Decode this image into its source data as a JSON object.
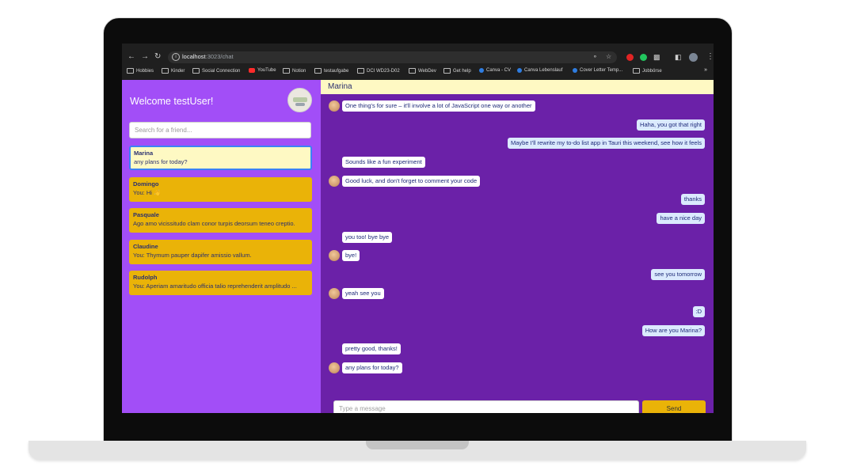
{
  "browser": {
    "url_host": "localhost",
    "url_path": ":3023/chat",
    "bookmarks": [
      {
        "label": "Hobbies",
        "icon": "folder-icon"
      },
      {
        "label": "Kinder",
        "icon": "folder-icon"
      },
      {
        "label": "Social Connection",
        "icon": "folder-icon"
      },
      {
        "label": "YouTube",
        "icon": "youtube-icon"
      },
      {
        "label": "Notion",
        "icon": "folder-icon"
      },
      {
        "label": "testaufgabe",
        "icon": "folder-icon"
      },
      {
        "label": "DCI WD23-D02",
        "icon": "folder-icon"
      },
      {
        "label": "WebDev",
        "icon": "folder-icon"
      },
      {
        "label": "Get help",
        "icon": "folder-icon"
      },
      {
        "label": "Canva - CV",
        "icon": "canva-icon"
      },
      {
        "label": "Canva Lebenslauf",
        "icon": "canva-icon"
      },
      {
        "label": "Cover Letter Temp...",
        "icon": "canva-icon"
      },
      {
        "label": "Jobbörse",
        "icon": "folder-icon"
      }
    ],
    "more": "»"
  },
  "sidebar": {
    "welcome": "Welcome testUser!",
    "search_placeholder": "Search for a friend...",
    "friends": [
      {
        "name": "Marina",
        "last": "any plans for today?"
      },
      {
        "name": "Domingo",
        "last": "You: Hi 👋"
      },
      {
        "name": "Pasquale",
        "last": "Ago amo vicissitudo clam conor turpis deorsum teneo creptio."
      },
      {
        "name": "Claudine",
        "last": "You: Thymum pauper dapifer amissio vallum."
      },
      {
        "name": "Rudolph",
        "last": "You: Aperiam amaritudo officia talio reprehenderit amplitudo ..."
      }
    ]
  },
  "chat": {
    "contact": "Marina",
    "messages": [
      {
        "from": "them",
        "text": "One thing's for sure – it'll involve a lot of JavaScript one way or another"
      },
      {
        "from": "me",
        "text": "Haha, you got that right"
      },
      {
        "from": "me",
        "text": "Maybe I'll rewrite my to-do list app in Tauri this weekend, see how it feels"
      },
      {
        "from": "them",
        "text": "Sounds like a fun experiment"
      },
      {
        "from": "them",
        "text": "Good luck, and don't forget to comment your code"
      },
      {
        "from": "me",
        "text": "thanks"
      },
      {
        "from": "me",
        "text": "have a nice day"
      },
      {
        "from": "them",
        "text": "you too! bye bye"
      },
      {
        "from": "them",
        "text": "bye!"
      },
      {
        "from": "me",
        "text": "see you tomorrow"
      },
      {
        "from": "them",
        "text": "yeah see you"
      },
      {
        "from": "me",
        "text": ":D"
      },
      {
        "from": "me",
        "text": "How are you Marina?"
      },
      {
        "from": "them",
        "text": "pretty good, thanks!"
      },
      {
        "from": "them",
        "text": "any plans for today?"
      }
    ],
    "input_placeholder": "Type a message",
    "send_label": "Send"
  }
}
